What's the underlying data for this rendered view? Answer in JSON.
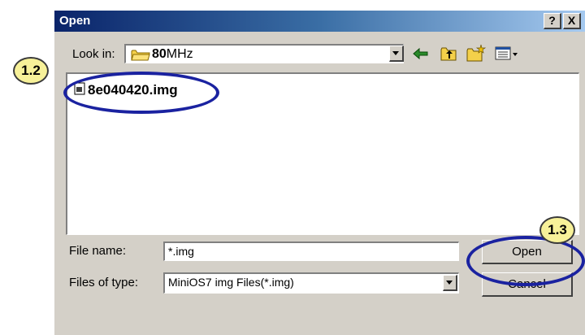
{
  "dialog": {
    "title": "Open",
    "help_label": "?",
    "close_label": "X"
  },
  "lookin": {
    "label": "Look in:",
    "folder_bold": "80",
    "folder_rest": "MHz"
  },
  "files": [
    {
      "name": "8e040420.img",
      "icon": "file-icon"
    }
  ],
  "filename": {
    "label": "File name:",
    "value": "*.img"
  },
  "filetype": {
    "label": "Files of type:",
    "value": "MiniOS7 img Files(*.img)"
  },
  "buttons": {
    "open": "Open",
    "cancel": "Cancel"
  },
  "callouts": {
    "step_a": "1.2",
    "step_b": "1.3"
  },
  "icons": [
    "back-arrow-icon",
    "up-folder-icon",
    "new-folder-icon",
    "view-menu-icon",
    "folder-icon",
    "dropdown-arrow-icon"
  ],
  "colors": {
    "callout_fill": "#f7f199",
    "highlight_ellipse": "#1a22a0",
    "title_bar": "#0a246a"
  }
}
